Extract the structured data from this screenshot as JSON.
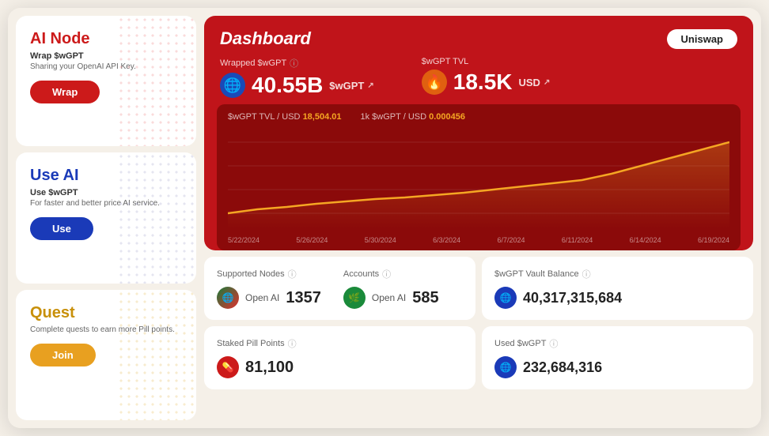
{
  "sidebar": {
    "cards": [
      {
        "id": "ai-node",
        "title": "AI Node",
        "title_color": "red",
        "subtitle": "Wrap $wGPT",
        "desc": "Sharing your OpenAI API Key.",
        "btn_label": "Wrap",
        "btn_class": "btn-red",
        "polka_class": "polka-red"
      },
      {
        "id": "use-ai",
        "title": "Use AI",
        "title_color": "blue",
        "subtitle": "Use $wGPT",
        "desc": "For faster and better price AI service.",
        "btn_label": "Use",
        "btn_class": "btn-blue",
        "polka_class": "polka-blue"
      },
      {
        "id": "quest",
        "title": "Quest",
        "title_color": "yellow",
        "subtitle": "",
        "desc": "Complete quests to earn more Pill points.",
        "btn_label": "Join",
        "btn_class": "btn-yellow",
        "polka_class": "polka-yellow"
      }
    ]
  },
  "dashboard": {
    "title": "Dashboard",
    "uniswap_label": "Uniswap",
    "wrapped_wgpt_label": "Wrapped $wGPT",
    "wgpt_tvl_label": "$wGPT TVL",
    "wrapped_amount": "40.55B",
    "wrapped_unit": "$wGPT",
    "tvl_amount": "18.5K",
    "tvl_unit": "USD",
    "chart": {
      "tvl_usd_label": "$wGPT TVL / USD",
      "tvl_usd_value": "18,504.01",
      "k_wgpt_label": "1k $wGPT / USD",
      "k_wgpt_value": "0.000456",
      "dates": [
        "5/22/2024",
        "5/26/2024",
        "5/30/2024",
        "6/3/2024",
        "6/7/2024",
        "6/11/2024",
        "6/14/2024",
        "6/19/2024"
      ]
    }
  },
  "stats": [
    {
      "id": "supported-nodes",
      "label": "Supported Nodes",
      "sub_label": "Open AI",
      "value": "1357",
      "icon_color": "green",
      "icon_emoji": "🌐"
    },
    {
      "id": "accounts",
      "label": "Accounts",
      "sub_label": "Open AI",
      "value": "585",
      "icon_color": "green",
      "icon_emoji": "🌿"
    },
    {
      "id": "wgpt-vault",
      "label": "$wGPT Vault Balance",
      "sub_label": "",
      "value": "40,317,315,684",
      "icon_color": "blue-dark",
      "icon_emoji": "🌐"
    },
    {
      "id": "staked-pill",
      "label": "Staked Pill Points",
      "sub_label": "",
      "value": "81,100",
      "icon_color": "red-icon",
      "icon_emoji": "💊"
    },
    {
      "id": "used-wgpt",
      "label": "Used $wGPT",
      "sub_label": "",
      "value": "232,684,316",
      "icon_color": "blue-dark",
      "icon_emoji": "🌐"
    }
  ],
  "icons": {
    "info": "ⓘ",
    "external": "↗"
  }
}
